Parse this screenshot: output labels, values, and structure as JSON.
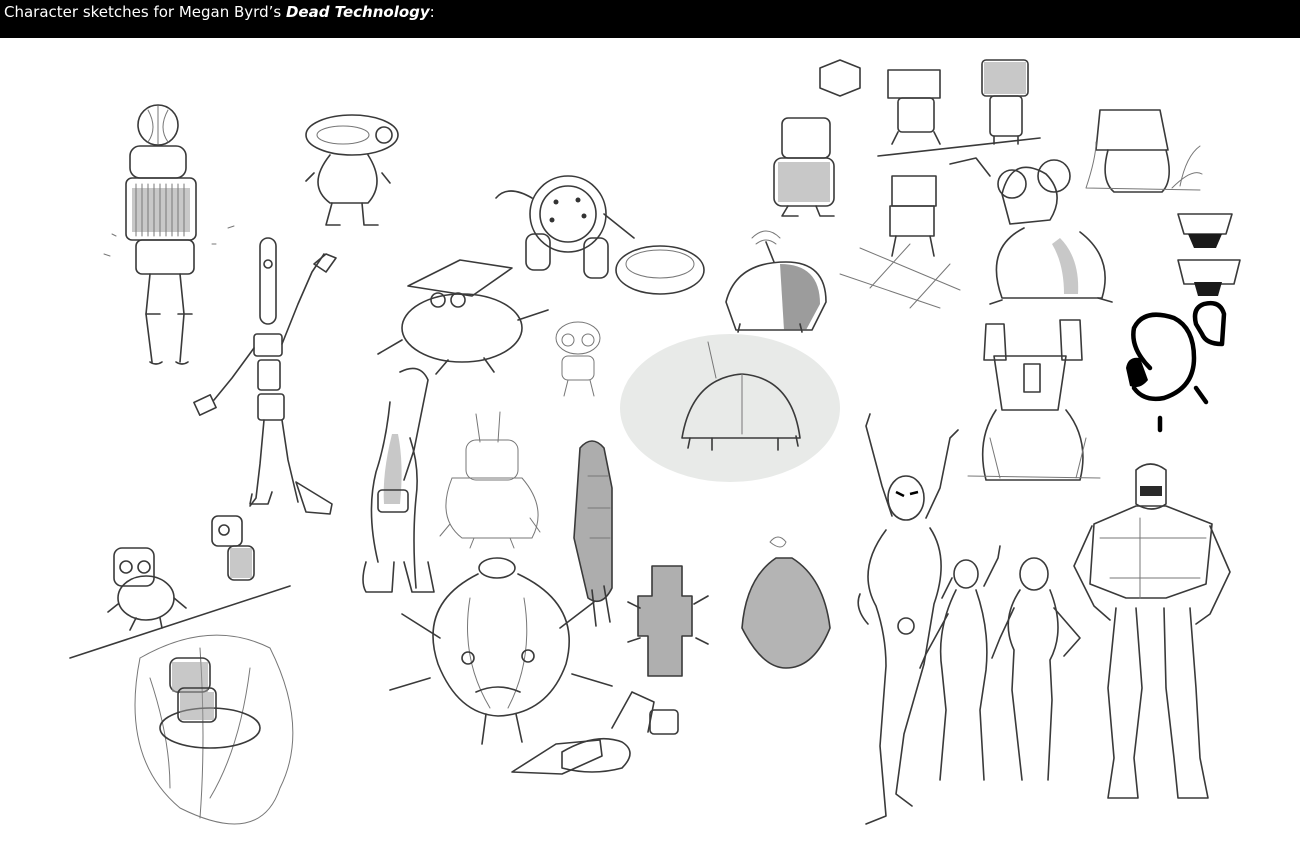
{
  "header": {
    "prefix": "Character sketches for Megan Byrd’s ",
    "title": "Dead Technology",
    "suffix": ":"
  },
  "colors": {
    "header_bg": "#000000",
    "header_text": "#ffffff",
    "sketch_ink": "#3a3a3a",
    "page_bg": "#ffffff"
  }
}
